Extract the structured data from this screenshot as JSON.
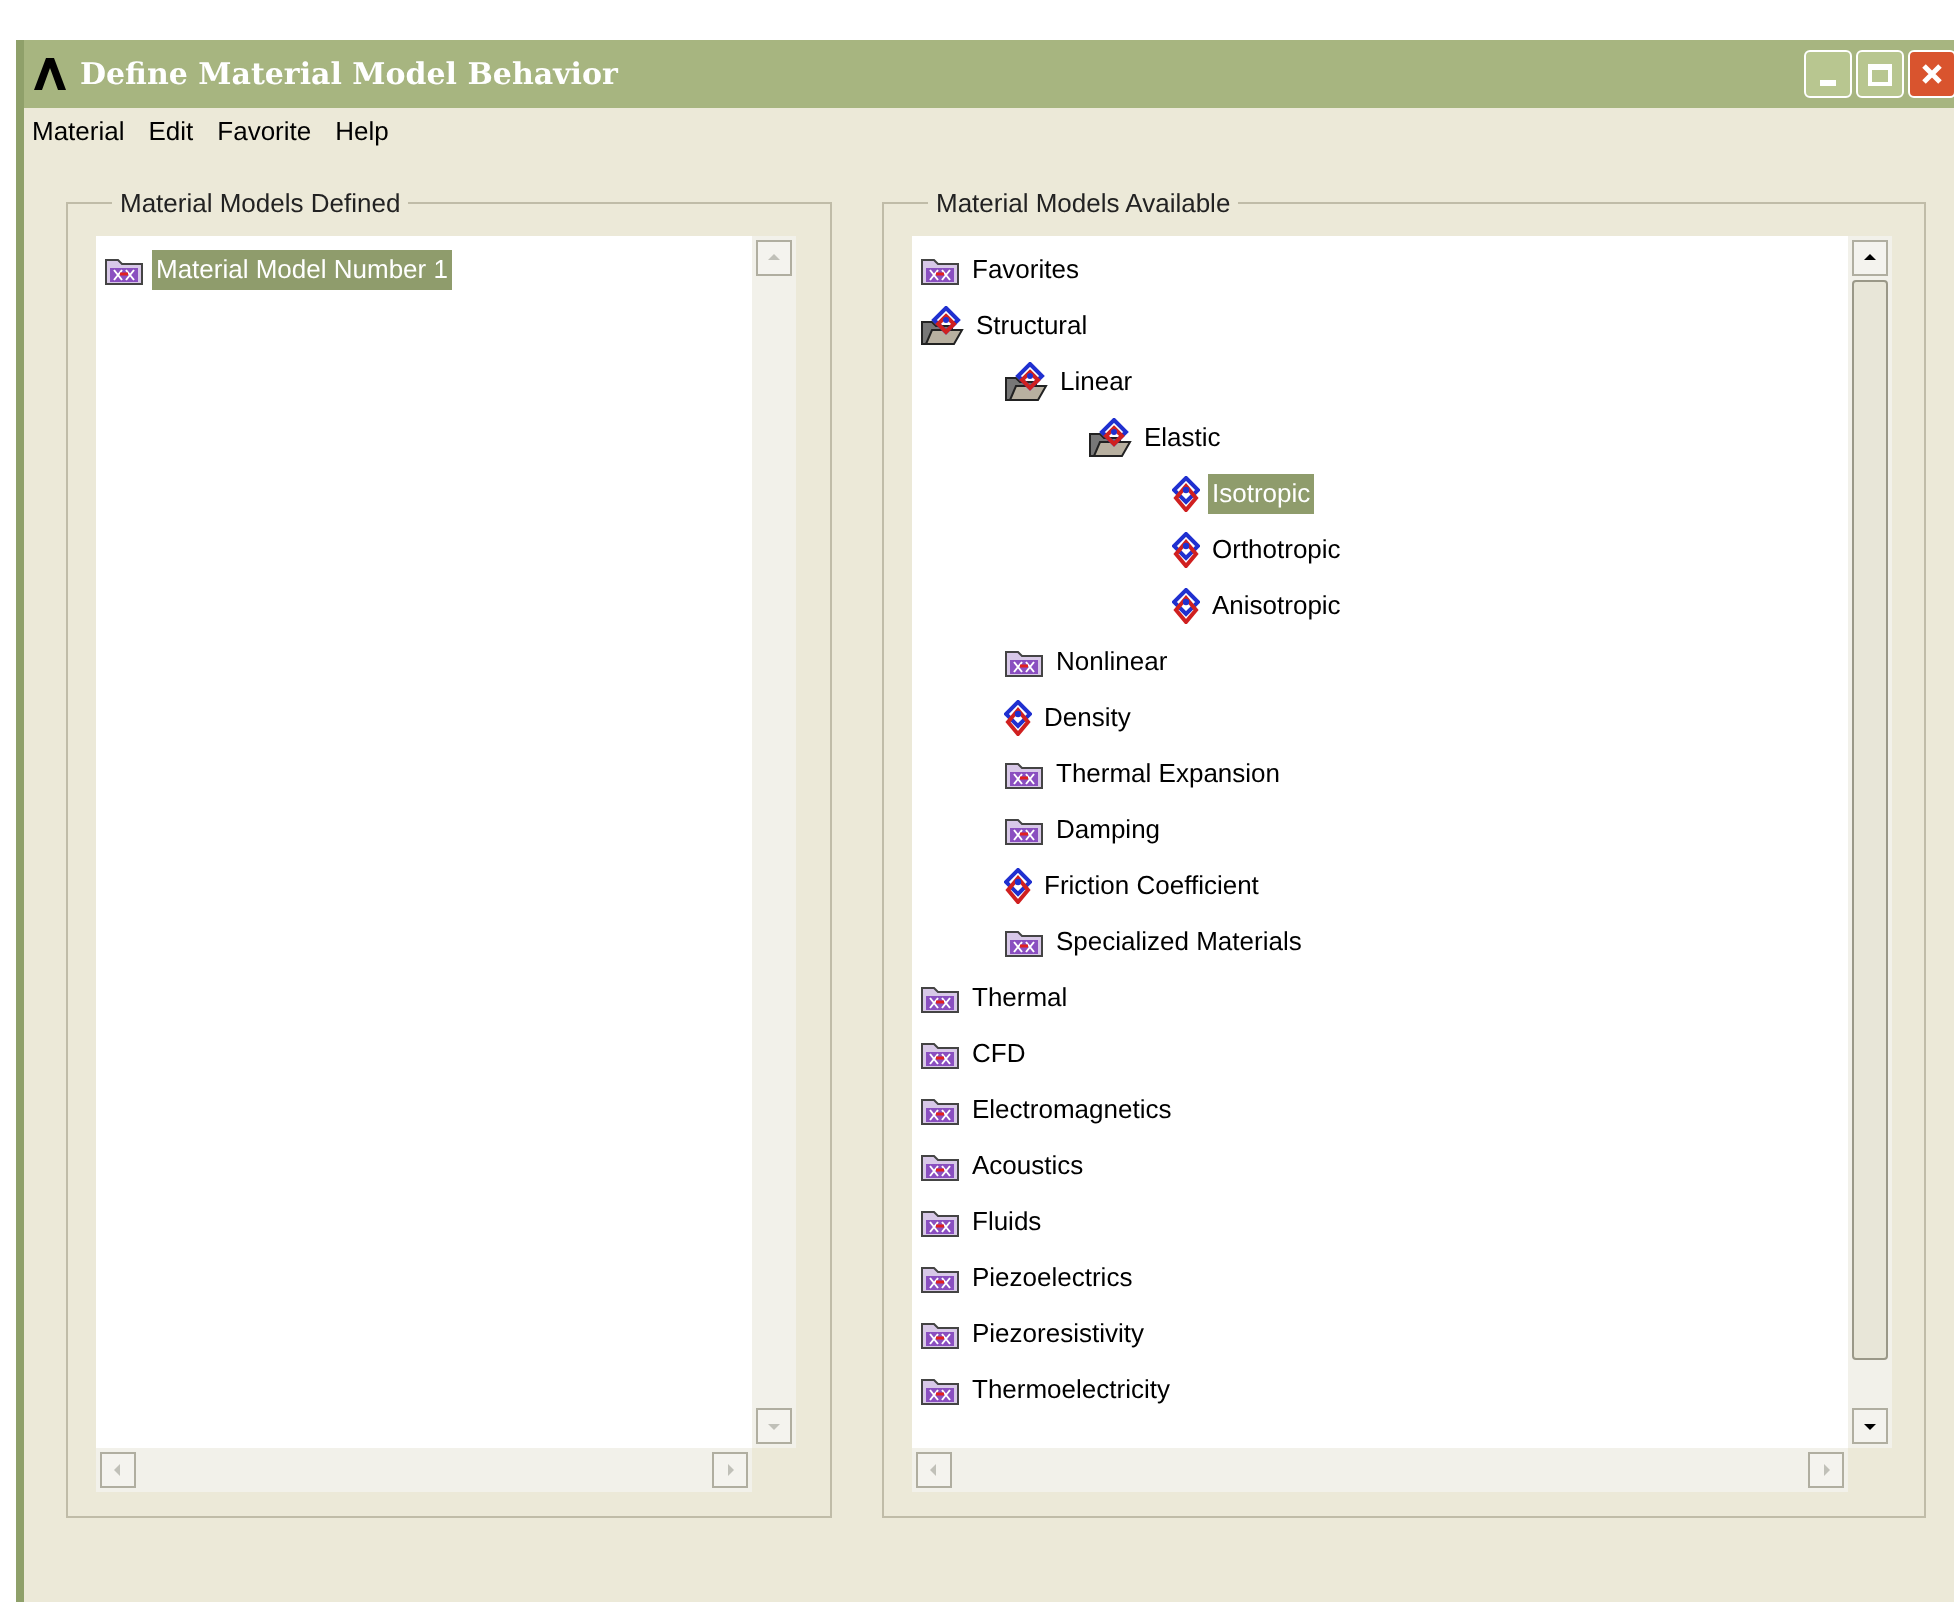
{
  "window": {
    "title": "Define Material Model Behavior"
  },
  "menu": [
    {
      "label": "Material"
    },
    {
      "label": "Edit"
    },
    {
      "label": "Favorite"
    },
    {
      "label": "Help"
    }
  ],
  "defined": {
    "title": "Material Models Defined",
    "items": [
      {
        "label": "Material Model Number 1",
        "selected": true
      }
    ]
  },
  "available": {
    "title": "Material Models Available",
    "tree": [
      {
        "label": "Favorites",
        "kind": "folder",
        "expanded": false,
        "selected": false
      },
      {
        "label": "Structural",
        "kind": "folder",
        "expanded": true,
        "selected": false,
        "children": [
          {
            "label": "Linear",
            "kind": "folder",
            "expanded": true,
            "selected": false,
            "children": [
              {
                "label": "Elastic",
                "kind": "folder",
                "expanded": true,
                "selected": false,
                "children": [
                  {
                    "label": "Isotropic",
                    "kind": "leaf",
                    "selected": true
                  },
                  {
                    "label": "Orthotropic",
                    "kind": "leaf",
                    "selected": false
                  },
                  {
                    "label": "Anisotropic",
                    "kind": "leaf",
                    "selected": false
                  }
                ]
              }
            ]
          },
          {
            "label": "Nonlinear",
            "kind": "folder",
            "expanded": false,
            "selected": false
          },
          {
            "label": "Density",
            "kind": "leaf",
            "selected": false
          },
          {
            "label": "Thermal Expansion",
            "kind": "folder",
            "expanded": false,
            "selected": false
          },
          {
            "label": "Damping",
            "kind": "folder",
            "expanded": false,
            "selected": false
          },
          {
            "label": "Friction Coefficient",
            "kind": "leaf",
            "selected": false
          },
          {
            "label": "Specialized Materials",
            "kind": "folder",
            "expanded": false,
            "selected": false
          }
        ]
      },
      {
        "label": "Thermal",
        "kind": "folder",
        "expanded": false,
        "selected": false
      },
      {
        "label": "CFD",
        "kind": "folder",
        "expanded": false,
        "selected": false
      },
      {
        "label": "Electromagnetics",
        "kind": "folder",
        "expanded": false,
        "selected": false
      },
      {
        "label": "Acoustics",
        "kind": "folder",
        "expanded": false,
        "selected": false
      },
      {
        "label": "Fluids",
        "kind": "folder",
        "expanded": false,
        "selected": false
      },
      {
        "label": "Piezoelectrics",
        "kind": "folder",
        "expanded": false,
        "selected": false
      },
      {
        "label": "Piezoresistivity",
        "kind": "folder",
        "expanded": false,
        "selected": false
      },
      {
        "label": "Thermoelectricity",
        "kind": "folder",
        "expanded": false,
        "selected": false
      }
    ]
  }
}
